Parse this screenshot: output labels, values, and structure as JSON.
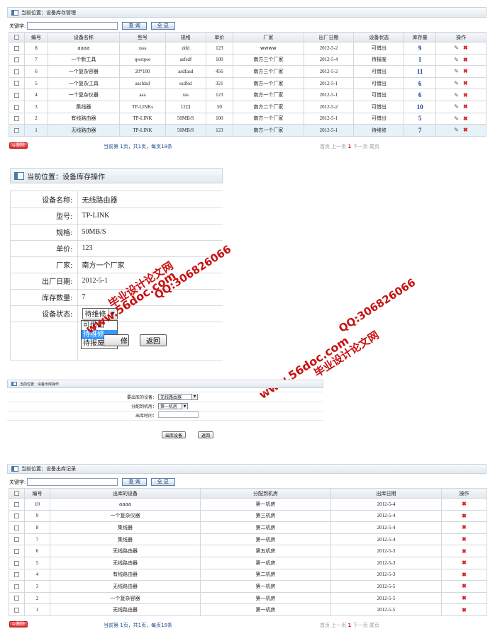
{
  "s1": {
    "breadcrumb": "当前位置：设备库存管理",
    "keyword_label": "关键字:",
    "keyword_value": "",
    "query_label": "查 询",
    "all_label": "全 显",
    "headers": [
      "",
      "编号",
      "设备名称",
      "型号",
      "规格",
      "单价",
      "厂家",
      "出厂日期",
      "设备状态",
      "库存量",
      "操作"
    ],
    "rows": [
      {
        "id": "8",
        "name": "aaaa",
        "model": "ssss",
        "spec": "ddd",
        "price": "123",
        "maker": "wwww",
        "date": "2012-5-2",
        "status": "可借出",
        "stock": "9"
      },
      {
        "id": "7",
        "name": "一个新工具",
        "model": "qwrqwe",
        "spec": "asfsdf",
        "price": "100",
        "maker": "南方三个厂家",
        "date": "2012-5-4",
        "status": "待报废",
        "stock": "1"
      },
      {
        "id": "6",
        "name": "一个复杂容器",
        "model": "20*100",
        "spec": "asdfasd",
        "price": "456",
        "maker": "南方三个厂家",
        "date": "2012-5-2",
        "status": "可借出",
        "stock": "11"
      },
      {
        "id": "5",
        "name": "一个复杂工具",
        "model": "assfdsd",
        "spec": "ssdfsd",
        "price": "321",
        "maker": "南方一个厂家",
        "date": "2012-5-1",
        "status": "可借出",
        "stock": "6"
      },
      {
        "id": "4",
        "name": "一个复杂仪器",
        "model": "aaa",
        "spec": "sss",
        "price": "123",
        "maker": "南方一个厂家",
        "date": "2012-5-1",
        "status": "可借出",
        "stock": "6"
      },
      {
        "id": "3",
        "name": "集线器",
        "model": "TP-LINKs",
        "spec": "12口",
        "price": "50",
        "maker": "南方二个厂家",
        "date": "2012-5-2",
        "status": "可借出",
        "stock": "10"
      },
      {
        "id": "2",
        "name": "有线路由器",
        "model": "TP-LINK",
        "spec": "50MB/S",
        "price": "100",
        "maker": "南方一个厂家",
        "date": "2012-5-1",
        "status": "可借出",
        "stock": "5"
      },
      {
        "id": "1",
        "name": "无线路由器",
        "model": "TP-LINK",
        "spec": "50MB/S",
        "price": "123",
        "maker": "南方一个厂家",
        "date": "2012-5-1",
        "status": "待维修",
        "stock": "7"
      }
    ],
    "delete_label": "删除",
    "pager_info": "当前第 1页，共1页，每页18条",
    "pager_first": "首页",
    "pager_prev": "上一页",
    "pager_cur": "1",
    "pager_next": "下一页",
    "pager_last": "尾页"
  },
  "s2": {
    "breadcrumb": "当前位置：设备库存操作",
    "fields": [
      {
        "label": "设备名称:",
        "value": "无线路由器"
      },
      {
        "label": "型号:",
        "value": "TP-LINK"
      },
      {
        "label": "规格:",
        "value": "50MB/S"
      },
      {
        "label": "单价:",
        "value": "123"
      },
      {
        "label": "厂家:",
        "value": "南方一个厂家"
      },
      {
        "label": "出厂日期:",
        "value": "2012-5-1"
      },
      {
        "label": "库存数量:",
        "value": "7"
      }
    ],
    "status_label": "设备状态:",
    "status_selected": "待维修",
    "status_options": [
      "可借出",
      "待维修",
      "待报废"
    ],
    "submit_label": "修改",
    "back_label": "返回"
  },
  "watermarks": {
    "site": "www.56doc.com",
    "qq": "QQ:306826066",
    "name": "毕业设计论文网"
  },
  "s3": {
    "breadcrumb": "当前位置：设备出库操作",
    "device_label": "要出库的设备：",
    "device_value": "无线路由器",
    "room_label": "分配到机房：",
    "room_value": "第一机房",
    "time_label": "出库时间：",
    "time_value": "",
    "submit_label": "出库设备",
    "back_label": "返回"
  },
  "s4": {
    "breadcrumb": "当前位置：设备出库记录",
    "keyword_label": "关键字:",
    "query_label": "查 询",
    "all_label": "全 显",
    "headers": [
      "",
      "编号",
      "出库的设备",
      "分配到机房",
      "出库日期",
      "操作"
    ],
    "rows": [
      {
        "id": "10",
        "device": "aaaa",
        "room": "第一机房",
        "date": "2012-5-4"
      },
      {
        "id": "9",
        "device": "一个复杂仪器",
        "room": "第三机房",
        "date": "2012-5-4"
      },
      {
        "id": "8",
        "device": "集线器",
        "room": "第二机房",
        "date": "2012-5-4"
      },
      {
        "id": "7",
        "device": "集线器",
        "room": "第一机房",
        "date": "2012-5-4"
      },
      {
        "id": "6",
        "device": "无线路由器",
        "room": "第五机房",
        "date": "2012-5-3"
      },
      {
        "id": "5",
        "device": "无线路由器",
        "room": "第一机房",
        "date": "2012-5-3"
      },
      {
        "id": "4",
        "device": "有线路由器",
        "room": "第二机房",
        "date": "2012-5-3"
      },
      {
        "id": "3",
        "device": "无线路由器",
        "room": "第一机房",
        "date": "2012-5-5"
      },
      {
        "id": "2",
        "device": "一个复杂容器",
        "room": "第一机房",
        "date": "2012-5-5"
      },
      {
        "id": "1",
        "device": "无线路由器",
        "room": "第一机房",
        "date": "2012-5-5"
      }
    ],
    "delete_label": "删除",
    "pager_info": "当前第 1页，共1页，每页18条",
    "pager_first": "首页",
    "pager_prev": "上一页",
    "pager_cur": "1",
    "pager_next": "下一页",
    "pager_last": "尾页"
  },
  "icons": {
    "edit": "pencil-icon",
    "delete": "cross-icon",
    "breadcrumb": "window-icon"
  },
  "colors": {
    "delete_red": "#d42222",
    "stock_blue": "#1a3c9c",
    "watermark_red": "#c81010",
    "highlight_row": "#e7f2f8"
  }
}
